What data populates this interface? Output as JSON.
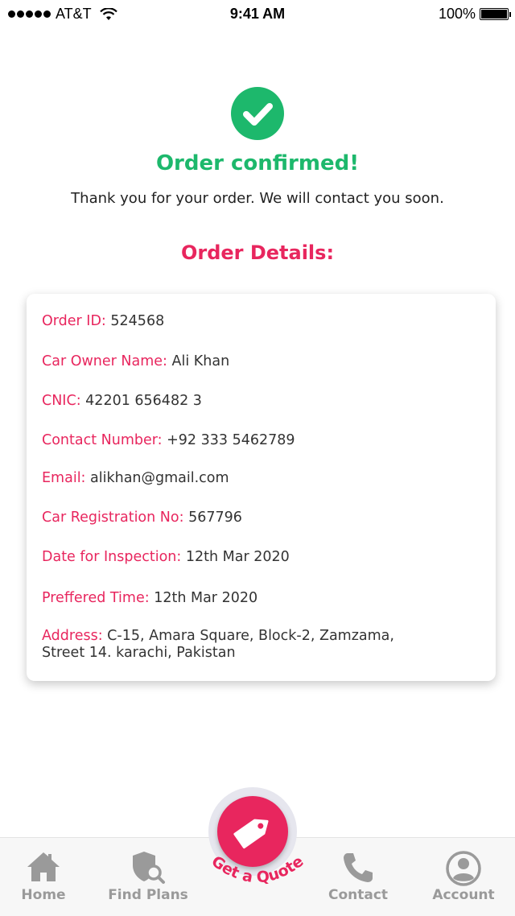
{
  "status_bar": {
    "carrier": "AT&T",
    "time": "9:41 AM",
    "battery": "100%"
  },
  "confirmation": {
    "title": "Order confirmed!",
    "message": "Thank you for your order. We will contact you soon.",
    "icon": "check-circle-icon"
  },
  "details": {
    "heading": "Order Details:",
    "fields": [
      {
        "label": "Order ID:",
        "value": "524568"
      },
      {
        "label": "Car Owner Name:",
        "value": "Ali Khan"
      },
      {
        "label": "CNIC:",
        "value": "42201 656482 3"
      },
      {
        "label": "Contact Number:",
        "value": "+92 333 5462789"
      },
      {
        "label": "Email:",
        "value": "alikhan@gmail.com"
      },
      {
        "label": "Car Registration No:",
        "value": "567796"
      },
      {
        "label": "Date for Inspection:",
        "value": "12th Mar 2020"
      },
      {
        "label": "Preffered Time:",
        "value": "12th Mar 2020"
      },
      {
        "label": "Address:",
        "value": "C-15, Amara Square, Block-2, Zamzama,",
        "value_line2": "Street 14. karachi, Pakistan"
      }
    ]
  },
  "nav": {
    "items": [
      {
        "label": "Home",
        "icon": "home-icon"
      },
      {
        "label": "Find Plans",
        "icon": "shield-search-icon"
      },
      {
        "label": "Contact",
        "icon": "phone-icon"
      },
      {
        "label": "Account",
        "icon": "user-icon"
      }
    ],
    "quote": {
      "label": "Get a Quote",
      "icon": "tag-icon"
    }
  },
  "colors": {
    "accent": "#e8265e",
    "success": "#1db86c",
    "nav_inactive": "#9a9a9a"
  }
}
